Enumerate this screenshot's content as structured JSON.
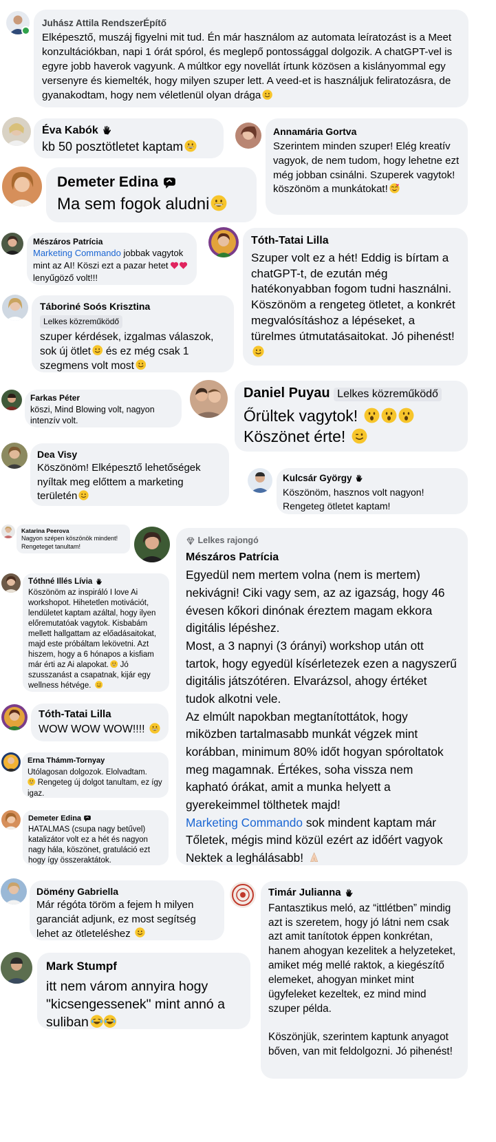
{
  "comments": {
    "c1": {
      "name": "Juhász Attila RendszerÉpítő",
      "text": "Elképesztő, muszáj figyelni mit tud. Én már használom az automata leíratozást is a Meet konzultációkban, napi 1 órát spórol, és meglepő pontossággal dolgozik. A chatGPT-vel is egyre jobb haverok vagyunk. A múltkor egy novellát írtunk közösen a kislányommal egy versenyre és kiemelték, hogy milyen szuper lett. A veed-et is használjuk feliratozásra, de gyanakodtam, hogy nem véletlenül olyan drága"
    },
    "c2": {
      "name": "Éva Kabók",
      "text": "kb 50 posztötletet kaptam"
    },
    "c3": {
      "name": "Annamária Gortva",
      "text": "Szerintem minden szuper! Elég kreatív vagyok, de nem tudom, hogy lehetne ezt még jobban csinálni. Szuperek vagytok! köszönöm a munkátokat!"
    },
    "c4": {
      "name": "Demeter Edina",
      "text": "Ma sem fogok aludni"
    },
    "c5": {
      "name": "Mészáros Patrícia",
      "link": "Marketing Commando",
      "text": " jobbak vagytok mint az AI! Köszi ezt a pazar hetet",
      "text2": " lenyűgöző volt!!!"
    },
    "c6": {
      "name": "Tóth-Tatai Lilla",
      "text": "Szuper volt ez a hét! Eddig is bírtam a chatGPT-t, de ezután még hatékonyabban fogom tudni használni. Köszönöm a rengeteg ötletet, a konkrét megvalósításhoz a lépéseket, a türelmes útmutatásaitokat. Jó pihenést!"
    },
    "c7": {
      "name": "Táboriné Soós Krisztina",
      "badge": "Lelkes közreműködő",
      "text": "szuper kérdések, izgalmas válaszok, sok új ötlet",
      "text2": " és ez még csak 1 szegmens volt most"
    },
    "c8": {
      "name": "Farkas Péter",
      "text": "köszi, Mind Blowing volt, nagyon intenzív volt."
    },
    "c9": {
      "name": "Daniel Puyau",
      "badge": "Lelkes közreműködő",
      "text": "Őrültek vagytok!",
      "text2": "Köszönet érte!"
    },
    "c10": {
      "name": "Dea Visy",
      "text": "Köszönöm! Elképesztő lehetőségek nyíltak meg előttem a marketing területén"
    },
    "c11": {
      "name": "Kulcsár György",
      "text": "Köszönöm, hasznos volt nagyon! Rengeteg ötletet kaptam!"
    },
    "c12": {
      "name": "Katarina Peerova",
      "text": "Nagyon szépen köszönök mindent! Rengeteget tanultam!"
    },
    "c13": {
      "badge": "Lelkes rajongó",
      "name": "Mészáros Patrícia",
      "p1": "Egyedül nem mertem volna (nem is mertem) nekivágni! Ciki vagy sem, az az igazság, hogy 46 évesen kőkori dinónak éreztem magam ekkora digitális lépéshez.",
      "p2": "Most, a 3 napnyi (3 órányi) workshop után ott tartok, hogy egyedül kísérletezek ezen a nagyszerű digitális játszótéren. Elvarázsol, ahogy értéket tudok alkotni vele.",
      "p3": "Az elmúlt napokban megtanítottátok, hogy miközben tartalmasabb munkát végzek mint korábban, minimum 80% időt hogyan spóroltatok meg magamnak. Értékes, soha vissza nem kapható órákat, amit a munka helyett a gyerekeimmel tölthetek majd!",
      "link": "Marketing Commando",
      "p4": " sok mindent kaptam már Tőletek, mégis mind közül ezért az időért vagyok Nektek a leghálásabb!"
    },
    "c14": {
      "name": "Tóthné Illés Lívia",
      "text": "Köszönöm az inspiráló I love Ai workshopot. Hihetetlen motivációt, lendületet kaptam azáltal, hogy ilyen előremutatóak vagytok. Kisbabám mellett hallgattam az előadásaitokat, majd este próbáltam lekövetni. Azt hiszem, hogy a 6 hónapos a kisfiam már érti az Ai alapokat.",
      "text2": " Jó szusszanást a csapatnak, kijár egy wellness hétvége."
    },
    "c15": {
      "name": "Tóth-Tatai Lilla",
      "text": "WOW WOW WOW!!!!"
    },
    "c16": {
      "name": "Erna Thámm-Tornyay",
      "text": "Utólagosan dolgozok. Elolvadtam.",
      "text2": " Rengeteg új dolgot tanultam, ez így igaz."
    },
    "c17": {
      "name": "Demeter Edina",
      "text": "HATALMAS (csupa nagy betűvel) katalizátor volt ez a hét és nagyon nagy hála, köszönet, gratuláció ezt hogy így összeraktátok."
    },
    "c18": {
      "name": "Dömény Gabriella",
      "text": "Már régóta töröm a fejem h milyen garanciát adjunk, ez most segítség lehet az ötleteléshez"
    },
    "c19": {
      "name": "Timár Julianna",
      "p1": "Fantasztikus meló, az “itt­létben” mindig azt is szeretem, hogy jó látni nem csak azt amit tanítotok éppen konkrétan, hanem ahogyan kezelitek a helyzeteket, amiket még mellé raktok, a kiegészítő elemeket, ahogyan minket mint ügyfeleket kezeltek, ez mind mind szuper példa.",
      "p2": "Köszönjük, szerintem kaptunk anyagot bőven, van mit feldolgozni. Jó pihenést!"
    },
    "c20": {
      "name": "Mark Stumpf",
      "text": "itt nem várom annyira hogy \"kicsengessenek\" mint annó a suliban"
    }
  },
  "colors": {
    "bubble": "#f0f2f5",
    "link": "#1b66d3",
    "online": "#31a24c"
  }
}
